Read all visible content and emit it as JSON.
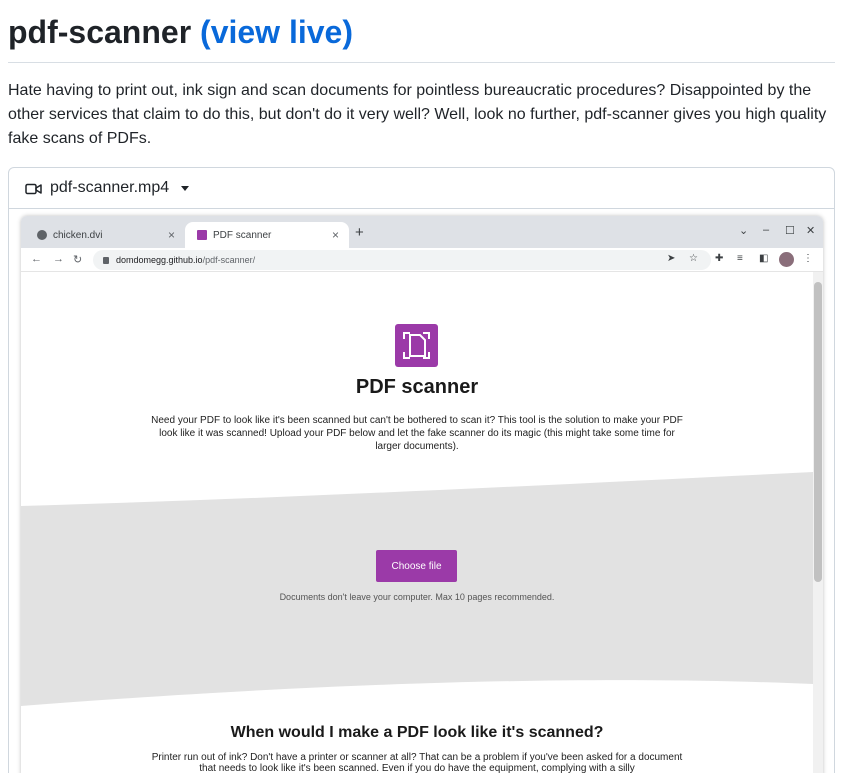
{
  "readme": {
    "title": "pdf-scanner",
    "view_live": "(view live)",
    "intro": "Hate having to print out, ink sign and scan documents for pointless bureaucratic procedures? Disappointed by the other services that claim to do this, but don't do it very well? Well, look no further, pdf-scanner gives you high quality fake scans of PDFs."
  },
  "video": {
    "filename": "pdf-scanner.mp4"
  },
  "browser": {
    "tabs": [
      {
        "label": "chicken.dvi",
        "close": "×"
      },
      {
        "label": "PDF scanner",
        "close": "×"
      }
    ],
    "new_tab": "+",
    "url_host": "domdomegg.github.io",
    "url_path": "/pdf-scanner/"
  },
  "app": {
    "title": "PDF scanner",
    "description": "Need your PDF to look like it's been scanned but can't be bothered to scan it? This tool is the solution to make your PDF look like it was scanned! Upload your PDF below and let the fake scanner do its magic (this might take some time for larger documents).",
    "choose_file": "Choose file",
    "upload_note": "Documents don't leave your computer. Max 10 pages recommended.",
    "section_title": "When would I make a PDF look like it's scanned?",
    "section_text": "Printer run out of ink? Don't have a printer or scanner at all? That can be a problem if you've been asked for a document that needs to look like it's been scanned. Even if you do have the equipment, complying with a silly"
  },
  "colors": {
    "link": "#0969da",
    "brand_purple": "#9b3aa8",
    "band_gray": "#e2e2e2"
  }
}
